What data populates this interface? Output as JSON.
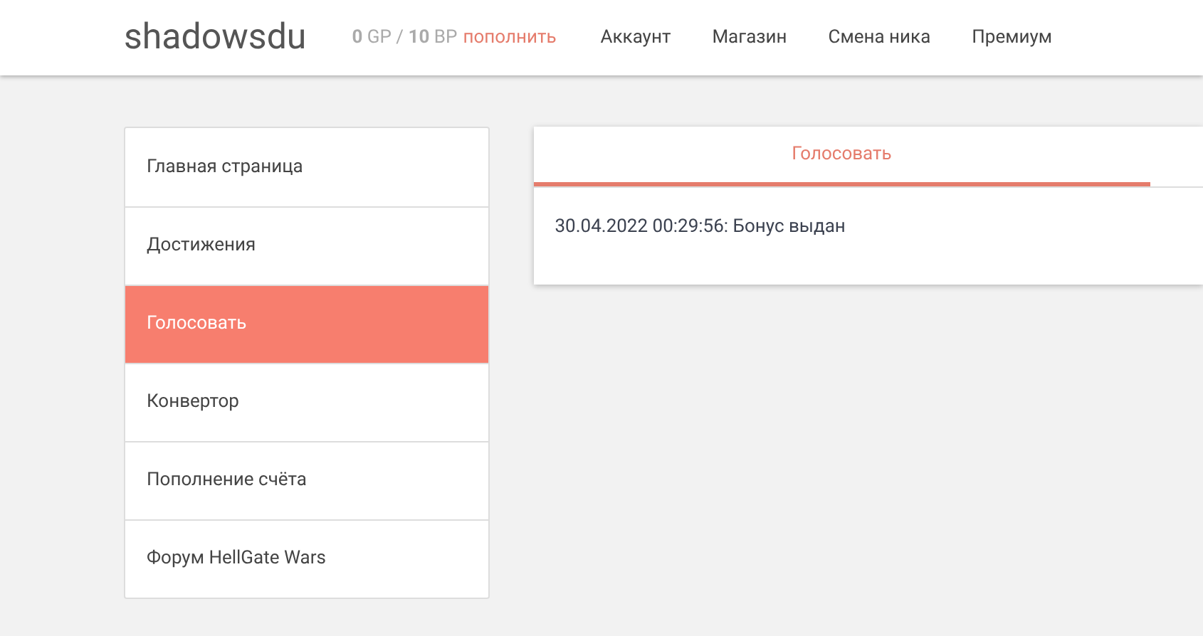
{
  "header": {
    "logo": "shadowsdu",
    "balance": "**0** GP / **10** BP",
    "topup_link": "пополнить",
    "nav": [
      "Аккаунт",
      "Магазин",
      "Смена ника",
      "Премиум"
    ]
  },
  "sidebar": {
    "items": [
      {
        "label": "Главная страница",
        "selected": false
      },
      {
        "label": "Достижения",
        "selected": false
      },
      {
        "label": "Голосовать",
        "selected": true
      },
      {
        "label": "Конвертор",
        "selected": false
      },
      {
        "label": "Пополнение счёта",
        "selected": false
      },
      {
        "label": "Форум HellGate Wars",
        "selected": false
      }
    ]
  },
  "panel": {
    "tabs": [
      {
        "label": "Голосовать",
        "selected": true
      }
    ],
    "log": [
      "30.04.2022 00:29:56: Бонус выдан"
    ]
  }
}
